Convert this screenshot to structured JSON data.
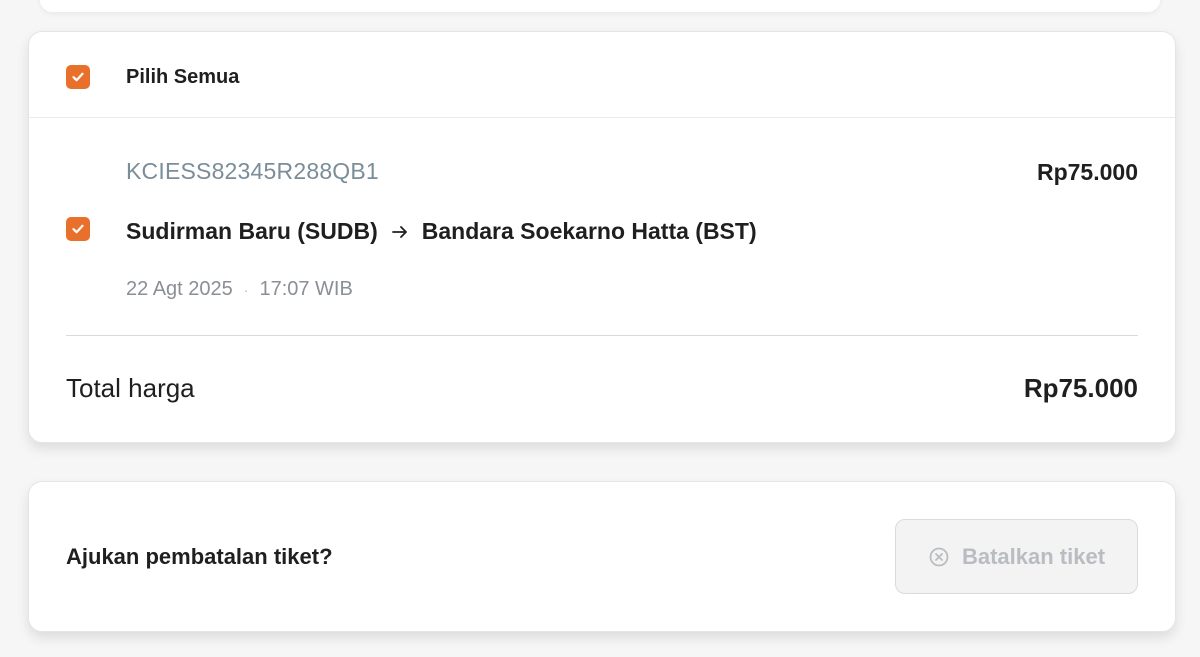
{
  "select_all": {
    "label": "Pilih Semua",
    "checked": true
  },
  "ticket": {
    "code": "KCIESS82345R288QB1",
    "price": "Rp75.000",
    "checked": true,
    "origin": "Sudirman Baru (SUDB)",
    "destination": "Bandara Soekarno Hatta (BST)",
    "date": "22 Agt 2025",
    "separator": "·",
    "time": "17:07 WIB"
  },
  "total": {
    "label": "Total harga",
    "value": "Rp75.000"
  },
  "cancel": {
    "question": "Ajukan pembatalan tiket?",
    "button_label": "Batalkan tiket",
    "button_disabled": true
  },
  "colors": {
    "accent": "#e8702a",
    "muted_code": "#7a8d99",
    "disabled_text": "#b9bcc0"
  }
}
